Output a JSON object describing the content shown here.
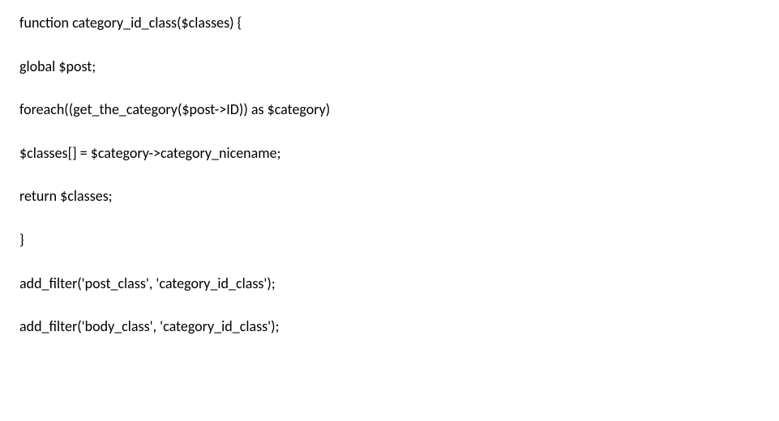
{
  "code": {
    "lines": [
      "function category_id_class($classes) {",
      "global $post;",
      "foreach((get_the_category($post->ID)) as $category)",
      "$classes[] = $category->category_nicename;",
      "return $classes;",
      "}",
      "add_filter('post_class', 'category_id_class');",
      "add_filter('body_class', 'category_id_class');"
    ]
  }
}
